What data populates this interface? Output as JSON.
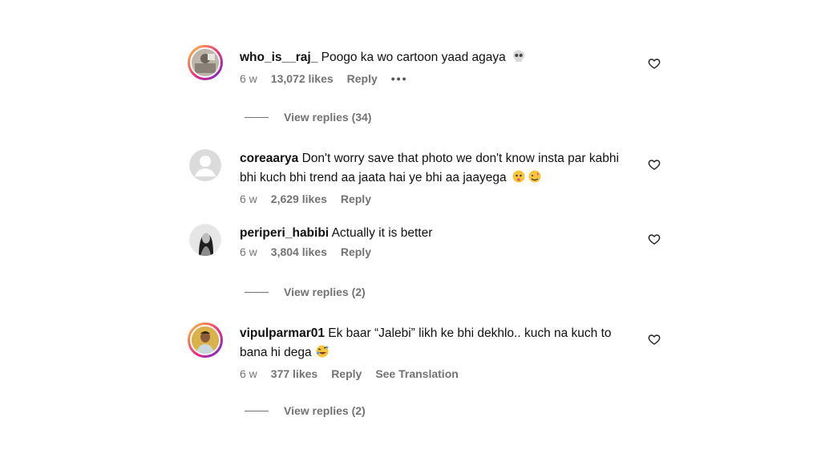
{
  "comments": [
    {
      "username": "who_is__raj_",
      "text": "Poogo ka wo cartoon yaad agaya",
      "emoji": "skull-emoji",
      "age": "6 w",
      "likes": "13,072 likes",
      "reply": "Reply",
      "more": "•••",
      "view_replies": "View replies (34)"
    },
    {
      "username": "coreaarya",
      "text": "Don't worry save that photo we don't know insta par kabhi bhi kuch bhi trend aa jaata hai ye bhi aa jaayega",
      "emoji": "face-emojis",
      "age": "6 w",
      "likes": "2,629 likes",
      "reply": "Reply"
    },
    {
      "username": "periperi_habibi",
      "text": "Actually it is better",
      "age": "6 w",
      "likes": "3,804 likes",
      "reply": "Reply",
      "view_replies": "View replies (2)"
    },
    {
      "username": "vipulparmar01",
      "text": "Ek baar “Jalebi” likh ke bhi dekhlo.. kuch na kuch to bana hi dega",
      "emoji": "rofl-emoji",
      "age": "6 w",
      "likes": "377 likes",
      "reply": "Reply",
      "translate": "See Translation",
      "view_replies": "View replies (2)"
    }
  ]
}
